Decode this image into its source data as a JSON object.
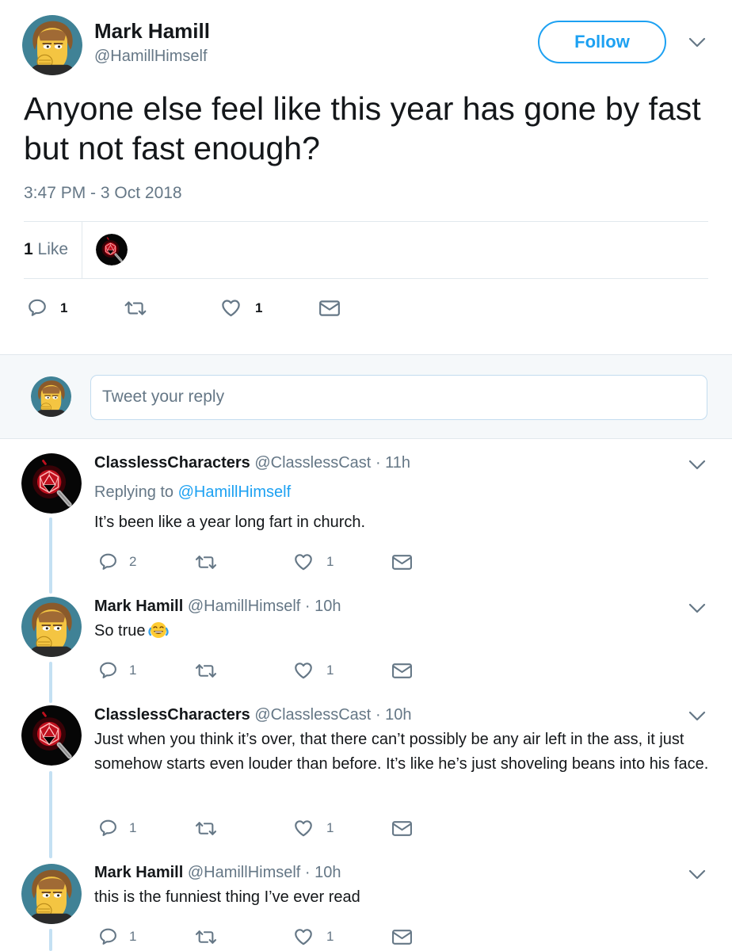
{
  "main_tweet": {
    "author_name": "Mark Hamill",
    "author_handle": "@HamillHimself",
    "follow_label": "Follow",
    "text": "Anyone else feel like this year has gone by fast but not fast enough?",
    "timestamp": "3:47 PM - 3 Oct 2018",
    "likes_number": "1",
    "likes_word": " Like",
    "actions": {
      "replies": "1",
      "likes": "1"
    }
  },
  "compose": {
    "placeholder": "Tweet your reply"
  },
  "replies": [
    {
      "name": "ClasslessCharacters",
      "handle": "@ClasslessCast",
      "separator": "·",
      "time": "11h",
      "replying_prefix": "Replying to ",
      "replying_to": "@HamillHimself",
      "text": "It’s been like a year long fart in church.",
      "replies": "2",
      "likes": "1"
    },
    {
      "name": "Mark Hamill",
      "handle": "@HamillHimself",
      "separator": "·",
      "time": "10h",
      "text": "So true",
      "replies": "1",
      "likes": "1"
    },
    {
      "name": "ClasslessCharacters",
      "handle": "@ClasslessCast",
      "separator": "·",
      "time": "10h",
      "text": "Just when you think it’s over, that there can’t possibly be any air left in the ass, it just somehow starts even louder than before. It’s like he’s just shoveling beans into his face.",
      "replies": "1",
      "likes": "1"
    },
    {
      "name": "Mark Hamill",
      "handle": "@HamillHimself",
      "separator": "·",
      "time": "10h",
      "text": "this is the funniest thing I’ve ever read",
      "replies": "1",
      "likes": "1"
    }
  ],
  "icons": {
    "reply": "reply-icon",
    "retweet": "retweet-icon",
    "like": "heart-icon",
    "dm": "envelope-icon",
    "caret": "chevron-down-icon"
  },
  "colors": {
    "accent": "#1da1f2",
    "secondary_text": "#657786",
    "border": "#e1e8ed",
    "thread_line": "#c4e0f3"
  }
}
